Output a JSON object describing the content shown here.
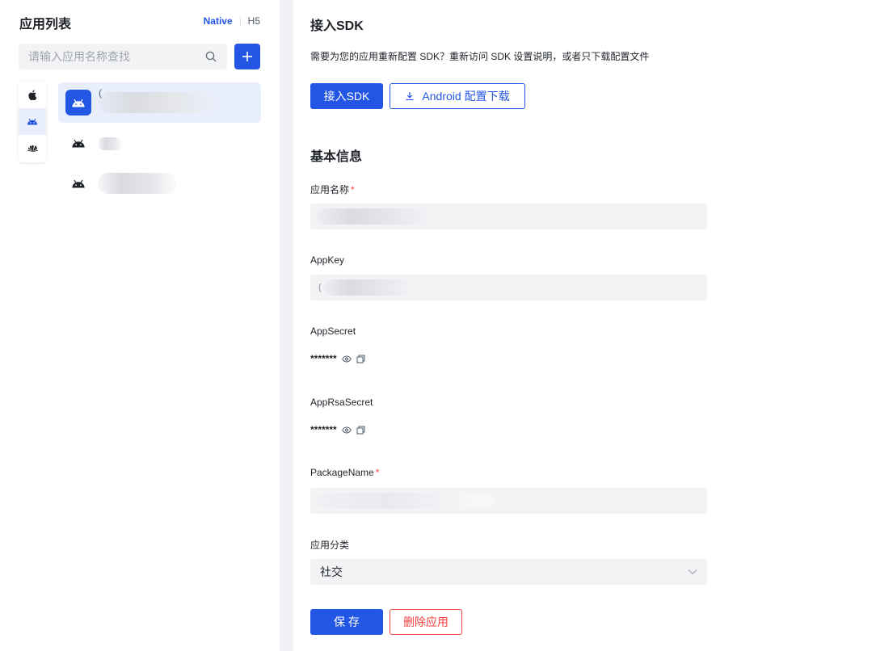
{
  "sidebar": {
    "title": "应用列表",
    "tabs": [
      {
        "label": "Native",
        "active": true
      },
      {
        "label": "H5",
        "active": false
      }
    ],
    "search_placeholder": "请输入应用名称查找",
    "add_label": "+",
    "platforms": [
      {
        "icon": "apple-icon",
        "active": false
      },
      {
        "icon": "android-icon",
        "active": true
      },
      {
        "icon": "huawei-icon",
        "active": false
      }
    ],
    "apps": [
      {
        "icon": "android-icon",
        "selected": true,
        "name": "("
      },
      {
        "icon": "android-icon",
        "selected": false,
        "name": ""
      },
      {
        "icon": "android-icon",
        "selected": false,
        "name": ""
      }
    ]
  },
  "main": {
    "sdk_section_title": "接入SDK",
    "sdk_description": "需要为您的应用重新配置 SDK？重新访问 SDK 设置说明，或者只下载配置文件",
    "sdk_button_label": "接入SDK",
    "download_button_label": "Android 配置下载",
    "basic_section_title": "基本信息",
    "fields": {
      "app_name_label": "应用名称",
      "app_key_label": "AppKey",
      "app_key_value": "(",
      "app_secret_label": "AppSecret",
      "app_secret_value": "*******",
      "app_rsa_secret_label": "AppRsaSecret",
      "app_rsa_secret_value": "*******",
      "package_name_label": "PackageName",
      "category_label": "应用分类",
      "category_value": "社交"
    },
    "required_mark": "*",
    "save_label": "保 存",
    "delete_label": "删除应用"
  },
  "colors": {
    "primary": "#2456e6",
    "danger": "#f53f3f",
    "selected_bg": "#e8eefc",
    "field_bg": "#f2f3f5"
  }
}
